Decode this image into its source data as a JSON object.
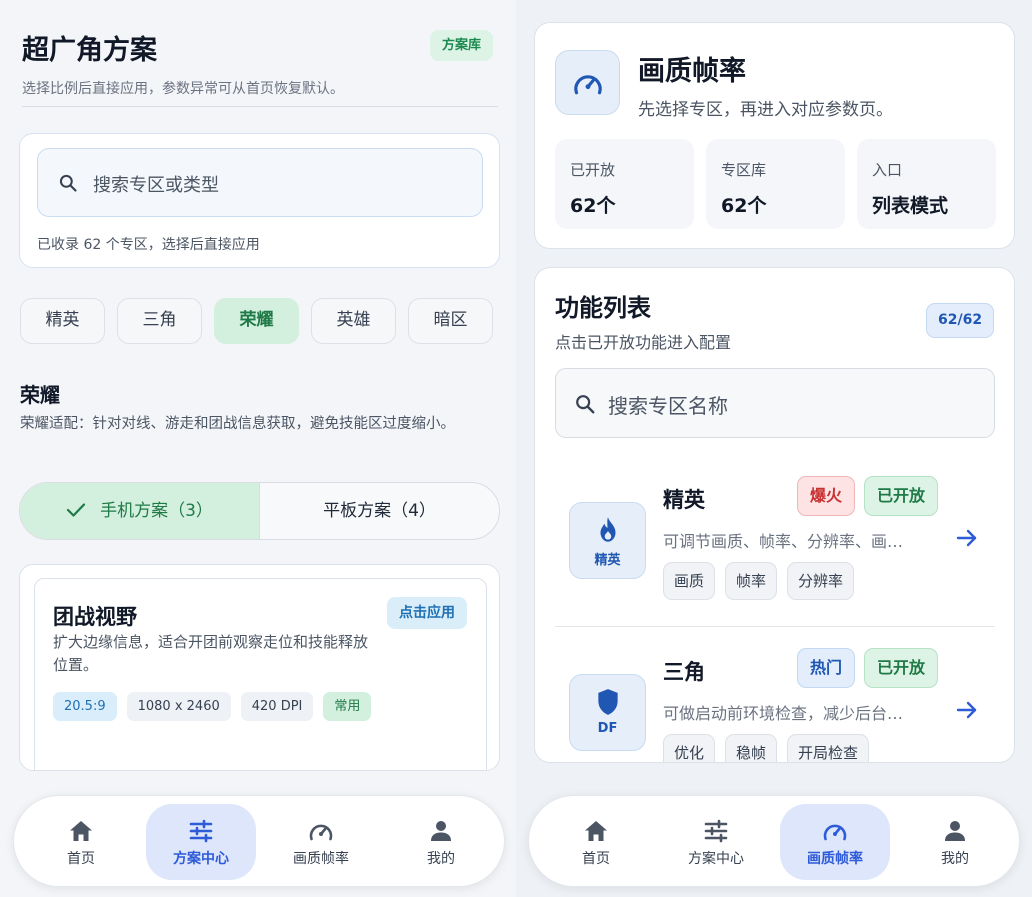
{
  "left": {
    "title": "超广角方案",
    "library_badge": "方案库",
    "subtitle": "选择比例后直接应用，参数异常可从首页恢复默认。",
    "search_placeholder": "搜索专区或类型",
    "collection_note": "已收录 62 个专区，选择后直接应用",
    "categories": [
      "精英",
      "三角",
      "荣耀",
      "英雄",
      "暗区"
    ],
    "selected_category": "荣耀",
    "section": {
      "title": "荣耀",
      "description": "荣耀适配：针对对线、游走和团战信息获取，避免技能区过度缩小。"
    },
    "segments": {
      "phone": "手机方案（3）",
      "tablet": "平板方案（4）",
      "selected": "phone"
    },
    "plan": {
      "title": "团战视野",
      "apply_label": "点击应用",
      "description": "扩大边缘信息，适合开团前观察走位和技能释放位置。",
      "ratio": "20.5:9",
      "resolution": "1080 x 2460",
      "dpi": "420 DPI",
      "tag": "常用"
    }
  },
  "nav": {
    "items": [
      {
        "label": "首页",
        "icon": "home-icon"
      },
      {
        "label": "方案中心",
        "icon": "sliders-icon"
      },
      {
        "label": "画质帧率",
        "icon": "speedometer-icon"
      },
      {
        "label": "我的",
        "icon": "person-icon"
      }
    ],
    "left_active": "方案中心",
    "right_active": "画质帧率"
  },
  "right": {
    "header": {
      "title": "画质帧率",
      "subtitle": "先选择专区，再进入对应参数页。",
      "icon": "speedometer-icon"
    },
    "stats": [
      {
        "label": "已开放",
        "value": "62个"
      },
      {
        "label": "专区库",
        "value": "62个"
      },
      {
        "label": "入口",
        "value": "列表模式"
      }
    ],
    "list": {
      "title": "功能列表",
      "subtitle": "点击已开放功能进入配置",
      "count": "62/62",
      "search_placeholder": "搜索专区名称",
      "rows": [
        {
          "name": "精英",
          "icon": "flame-icon",
          "abbr": "精英",
          "badge": "爆火",
          "status": "已开放",
          "description": "可调节画质、帧率、分辨率、画…",
          "tags": [
            "画质",
            "帧率",
            "分辨率"
          ]
        },
        {
          "name": "三角",
          "icon": "shield-icon",
          "abbr": "DF",
          "badge": "热门",
          "status": "已开放",
          "description": "可做启动前环境检查，减少后台…",
          "tags": [
            "优化",
            "稳帧",
            "开局检查"
          ]
        }
      ]
    }
  },
  "colors": {
    "accent_green": "#1f7a47",
    "accent_blue": "#2e5bd8",
    "hot_red": "#c93232"
  }
}
